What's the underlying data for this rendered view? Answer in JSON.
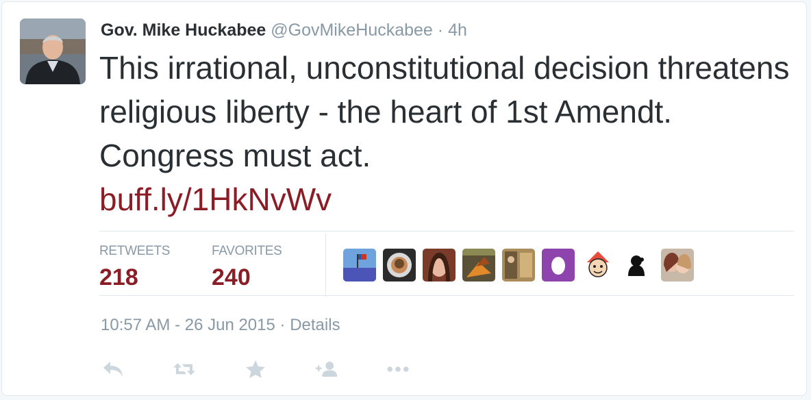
{
  "tweet": {
    "author": {
      "name": "Gov. Mike Huckabee",
      "handle": "@GovMikeHuckabee"
    },
    "separator": "·",
    "time_ago": "4h",
    "text": "This irrational, unconstitutional decision threatens religious liberty - the heart of 1st Amendt. Congress must act.",
    "link": "buff.ly/1HkNvWv",
    "stats": {
      "retweets_label": "RETWEETS",
      "retweets": "218",
      "favorites_label": "FAVORITES",
      "favorites": "240"
    },
    "timestamp": "10:57 AM - 26 Jun 2015",
    "details_label": "Details"
  },
  "actions": [
    "reply-icon",
    "retweet-icon",
    "favorite-icon",
    "follow-icon",
    "more-icon"
  ],
  "colors": {
    "link": "#8b1d26",
    "text": "#292f33",
    "muted": "#8899a6",
    "icon": "#ccd6dd",
    "border": "#e1e8ed"
  }
}
